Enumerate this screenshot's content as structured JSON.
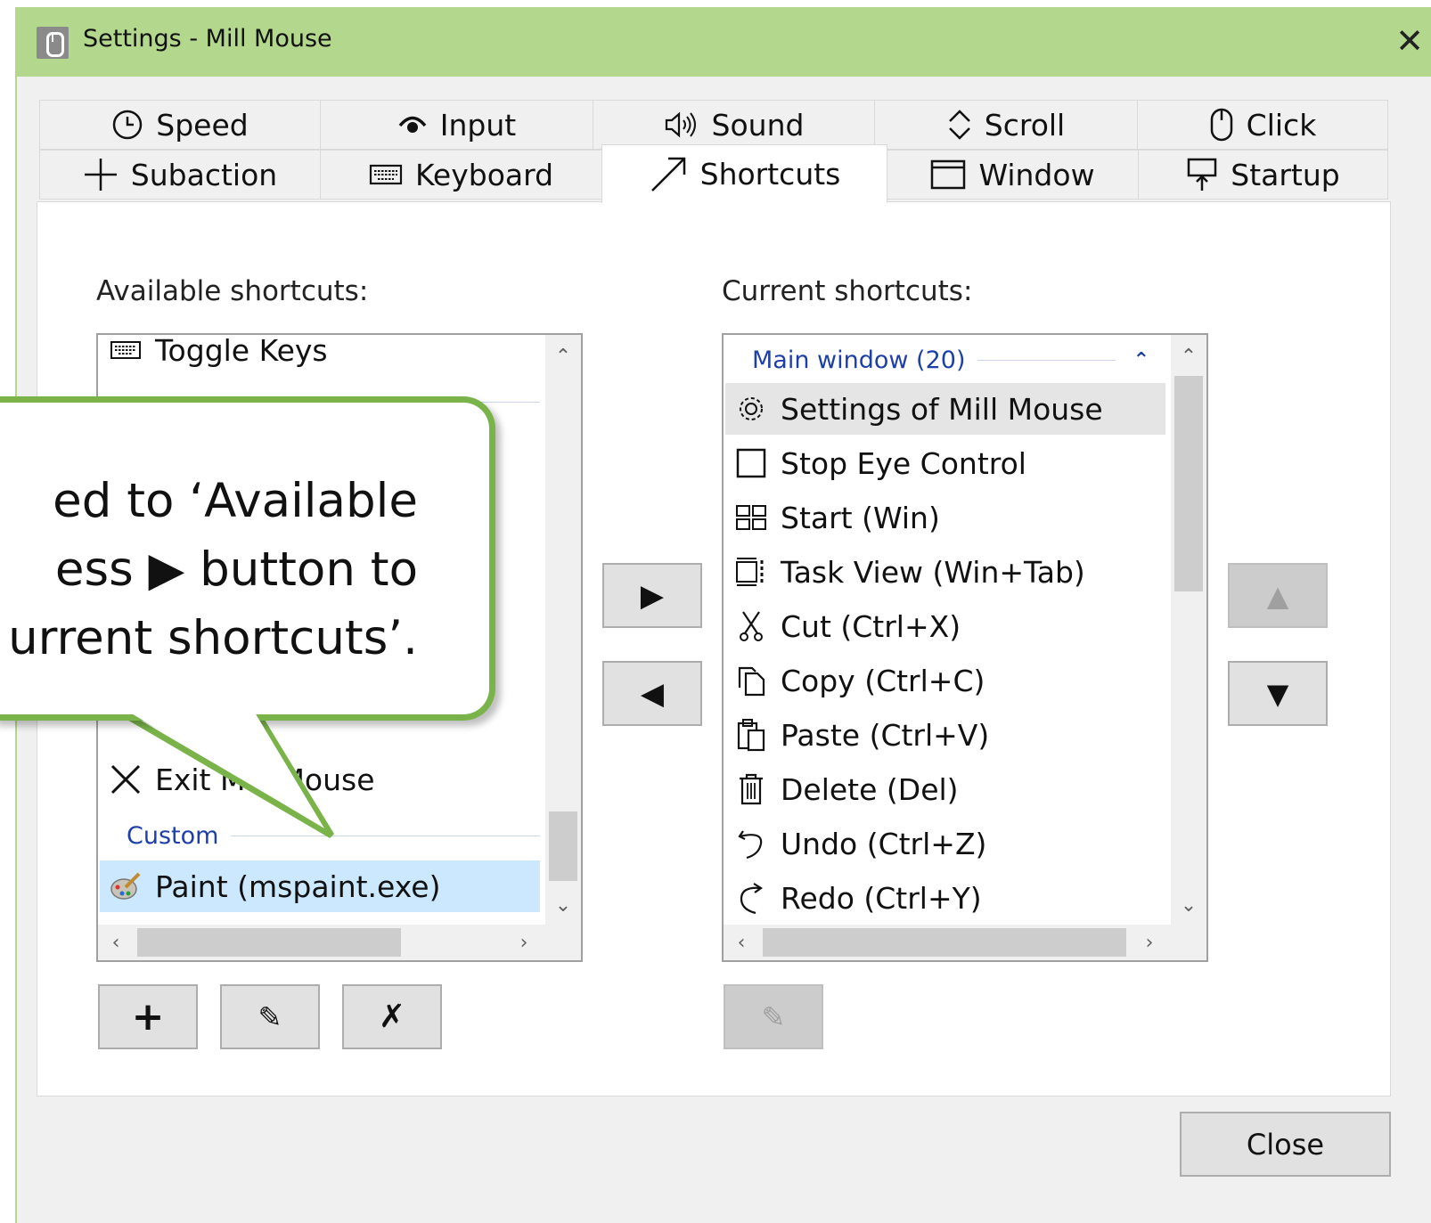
{
  "window": {
    "title": "Settings - Mill Mouse"
  },
  "tabs": [
    {
      "label": "Speed",
      "icon": "clock-icon"
    },
    {
      "label": "Input",
      "icon": "eye-icon"
    },
    {
      "label": "Sound",
      "icon": "speaker-icon"
    },
    {
      "label": "Scroll",
      "icon": "scroll-arrows-icon"
    },
    {
      "label": "Click",
      "icon": "mouse-icon"
    },
    {
      "label": "Subaction",
      "icon": "plus-icon"
    },
    {
      "label": "Keyboard",
      "icon": "keyboard-icon"
    },
    {
      "label": "Shortcuts",
      "icon": "arrow-diagonal-icon",
      "active": true
    },
    {
      "label": "Window",
      "icon": "window-icon"
    },
    {
      "label": "Startup",
      "icon": "startup-icon"
    }
  ],
  "available": {
    "label": "Available shortcuts:",
    "items": [
      {
        "label": "Toggle Keys",
        "icon": "keyboard-icon"
      },
      {
        "label": "Exit Mill Mouse",
        "icon": "close-icon"
      },
      {
        "label": "Paint (mspaint.exe)",
        "icon": "paint-icon",
        "selected": true
      }
    ],
    "groups": [
      "Custom"
    ],
    "buttons": {
      "add": "+",
      "edit": "✎",
      "delete": "✗"
    }
  },
  "current": {
    "label": "Current shortcuts:",
    "group": "Main window (20)",
    "items": [
      {
        "label": "Settings of Mill Mouse",
        "icon": "gear-icon",
        "selected": true
      },
      {
        "label": "Stop Eye Control",
        "icon": "square-icon"
      },
      {
        "label": "Start (Win)",
        "icon": "start-grid-icon"
      },
      {
        "label": "Task View (Win+Tab)",
        "icon": "task-view-icon"
      },
      {
        "label": "Cut (Ctrl+X)",
        "icon": "scissors-icon"
      },
      {
        "label": "Copy (Ctrl+C)",
        "icon": "copy-icon"
      },
      {
        "label": "Paste (Ctrl+V)",
        "icon": "paste-icon"
      },
      {
        "label": "Delete (Del)",
        "icon": "trash-icon"
      },
      {
        "label": "Undo (Ctrl+Z)",
        "icon": "undo-icon"
      },
      {
        "label": "Redo (Ctrl+Y)",
        "icon": "redo-icon"
      }
    ]
  },
  "move": {
    "right": "▶",
    "left": "◀",
    "up": "▲",
    "down": "▼"
  },
  "callout": {
    "lines": [
      "ed to ‘Available",
      "ess ▶ button to",
      "urrent shortcuts’."
    ]
  },
  "footer": {
    "close_label": "Close"
  },
  "colors": {
    "titlebar": "#b3d78d",
    "callout_border": "#7ab34a",
    "group_text": "#1e3fa8",
    "selected_blue": "#cce8ff"
  }
}
